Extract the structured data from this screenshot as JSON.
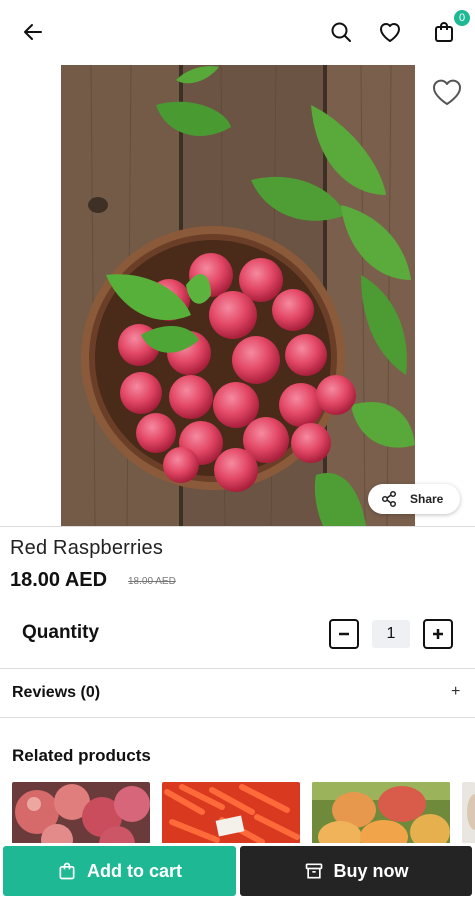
{
  "header": {
    "cart_count": "0",
    "icons": [
      "back-arrow-icon",
      "search-icon",
      "heart-icon",
      "shopping-bag-icon"
    ]
  },
  "product": {
    "name": "Red Raspberries",
    "price": "18.00 AED",
    "old_price": "18.00 AED",
    "share_label": "Share"
  },
  "quantity": {
    "label": "Quantity",
    "value": "1"
  },
  "reviews": {
    "label": "Reviews (0)",
    "expand": "+"
  },
  "related": {
    "title": "Related products",
    "items": [
      "apples",
      "carrots",
      "mangoes",
      "partial"
    ]
  },
  "actions": {
    "add_to_cart": "Add to cart",
    "buy_now": "Buy now"
  },
  "colors": {
    "accent": "#1fb895",
    "dark_button": "#242424"
  }
}
